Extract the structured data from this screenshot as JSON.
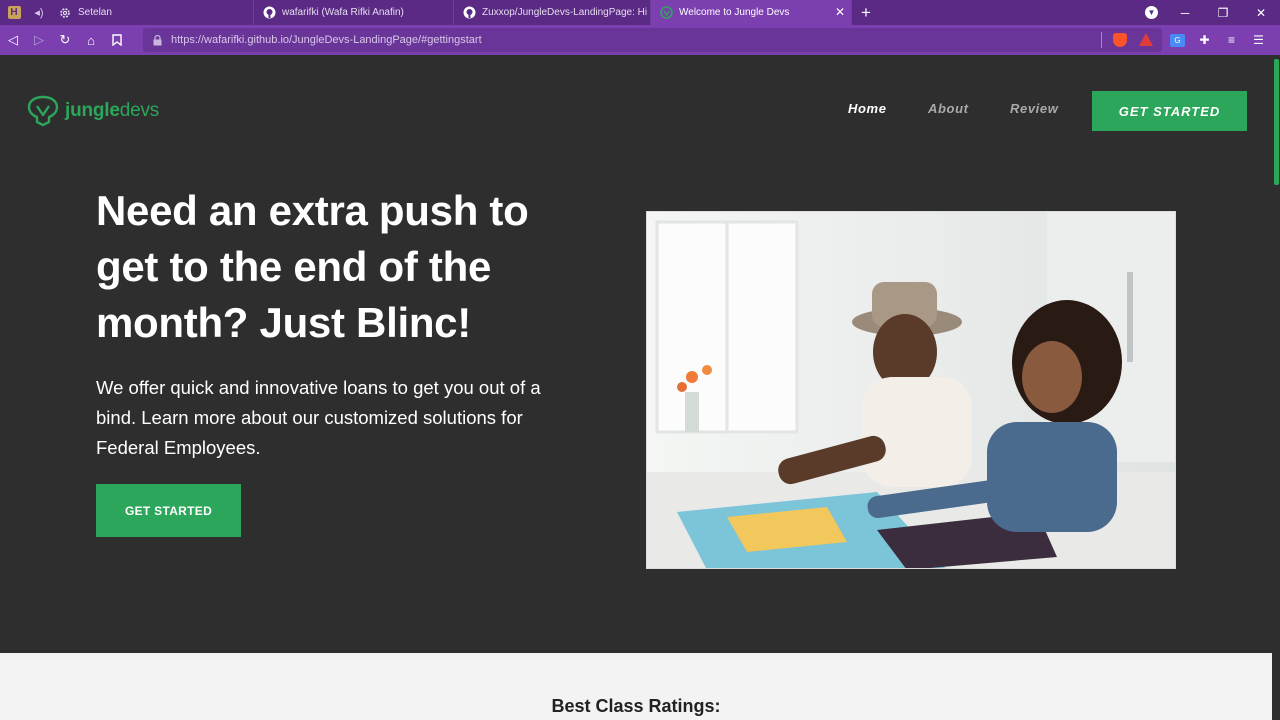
{
  "browser": {
    "tabs": [
      {
        "title": "Setelan",
        "icon": "gear-icon"
      },
      {
        "title": "wafarifki (Wafa Rifki Anafin)",
        "icon": "github-icon"
      },
      {
        "title": "Zuxxop/JungleDevs-LandingPage: Hi",
        "icon": "github-icon"
      },
      {
        "title": "Welcome to Jungle Devs",
        "icon": "jungledevs-favicon",
        "active": true
      }
    ],
    "url": "https://wafarifki.github.io/JungleDevs-LandingPage/#gettingstart"
  },
  "site": {
    "logo": {
      "part1": "jungle",
      "part2": "devs"
    },
    "nav": [
      {
        "label": "Home",
        "active": true
      },
      {
        "label": "About",
        "active": false
      },
      {
        "label": "Review",
        "active": false
      }
    ],
    "cta_top": "GET STARTED"
  },
  "hero": {
    "title": "Need an extra push to get to the end of the month? Just Blinc!",
    "subtitle": "We offer quick and innovative loans to get you out of a bind. Learn more about our customized solutions for Federal Employees.",
    "cta": "GET STARTED",
    "image_description": "father and daughter looking at a map"
  },
  "ratings": {
    "title": "Best Class Ratings:"
  },
  "colors": {
    "brand_green": "#2ba65a",
    "page_bg": "#2e2e2e",
    "browser_purple": "#7b3fb0"
  }
}
